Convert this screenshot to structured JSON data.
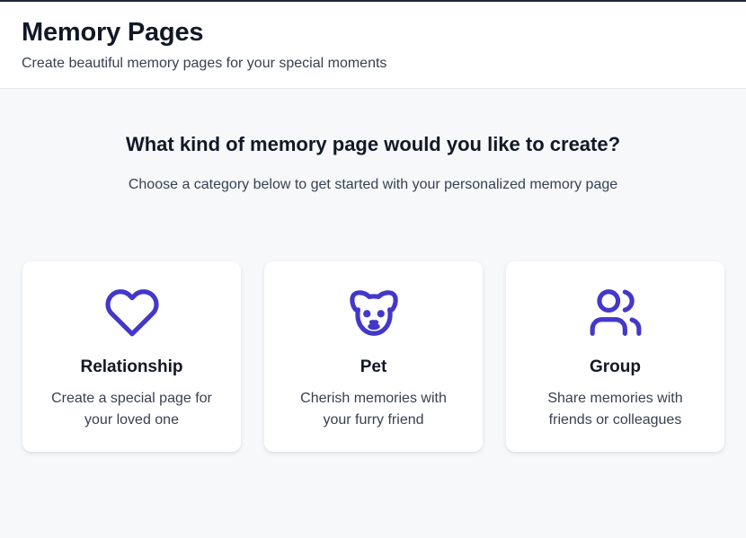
{
  "colors": {
    "accent": "#4338ca",
    "page_background": "#f7f8fa",
    "card_background": "#ffffff"
  },
  "header": {
    "title": "Memory Pages",
    "subtitle": "Create beautiful memory pages for your special moments"
  },
  "main": {
    "question": "What kind of memory page would you like to create?",
    "helper": "Choose a category below to get started with your personalized memory page"
  },
  "categories": [
    {
      "icon": "heart-icon",
      "title": "Relationship",
      "description": "Create a special page for your loved one"
    },
    {
      "icon": "dog-icon",
      "title": "Pet",
      "description": "Cherish memories with your furry friend"
    },
    {
      "icon": "users-icon",
      "title": "Group",
      "description": "Share memories with friends or colleagues"
    }
  ]
}
